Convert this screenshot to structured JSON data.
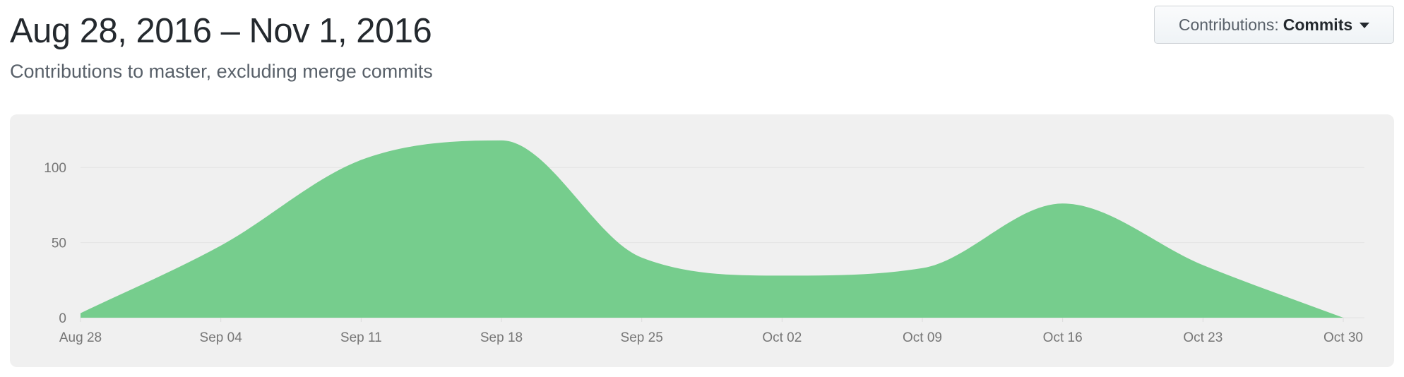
{
  "header": {
    "date_range": "Aug 28, 2016 – Nov 1, 2016",
    "subtitle": "Contributions to master, excluding merge commits"
  },
  "dropdown": {
    "prefix": "Contributions:",
    "value": "Commits"
  },
  "colors": {
    "area_fill": "#76cd8d",
    "panel_bg": "#f0f0f0",
    "gridline": "#e4e4e4"
  },
  "chart_data": {
    "type": "area",
    "title": "",
    "xlabel": "",
    "ylabel": "",
    "x": [
      "2016-08-28",
      "2016-09-04",
      "2016-09-11",
      "2016-09-18",
      "2016-09-25",
      "2016-10-02",
      "2016-10-09",
      "2016-10-16",
      "2016-10-23",
      "2016-10-30"
    ],
    "x_tick_labels": [
      "Aug 28",
      "Sep 04",
      "Sep 11",
      "Sep 18",
      "Sep 25",
      "Oct 02",
      "Oct 09",
      "Oct 16",
      "Oct 23",
      "Oct 30"
    ],
    "series": [
      {
        "values": [
          3,
          48,
          105,
          118,
          40,
          28,
          33,
          76,
          35,
          0
        ]
      }
    ],
    "y_ticks": [
      0,
      50,
      100
    ],
    "ylim": [
      0,
      125
    ],
    "grid": true,
    "legend": "none"
  }
}
